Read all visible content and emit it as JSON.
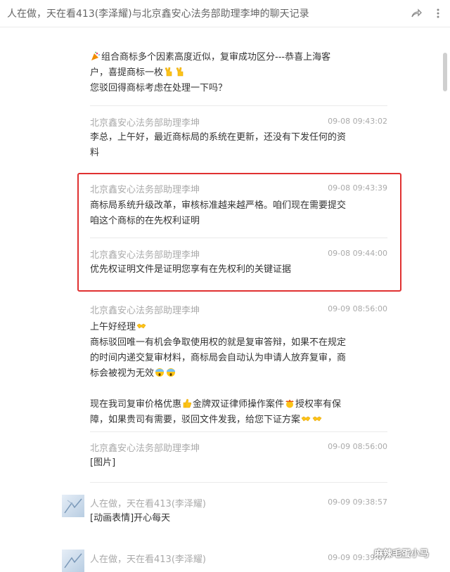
{
  "window": {
    "title": "人在做，天在看413(李泽耀)与北京鑫安心法务部助理李坤的聊天记录"
  },
  "messages": [
    {
      "lines": [
        "组合商标多个因素高度近似，复审成功区分---恭喜上海客",
        "户，喜提商标一枚",
        "您驳回得商标考虑在处理一下吗？"
      ]
    },
    {
      "sender": "北京鑫安心法务部助理李坤",
      "time": "09-08 09:43:02",
      "lines": [
        "李总，上午好，最近商标局的系统在更新，还没有下发任何的资",
        "料"
      ]
    },
    {
      "sender": "北京鑫安心法务部助理李坤",
      "time": "09-08 09:43:39",
      "lines": [
        "商标局系统升级改革，审核标准越来越严格。咱们现在需要提交",
        "咱这个商标的在先权利证明"
      ]
    },
    {
      "sender": "北京鑫安心法务部助理李坤",
      "time": "09-08 09:44:00",
      "lines": [
        "优先权证明文件是证明您享有在先权利的关键证据"
      ]
    },
    {
      "sender": "北京鑫安心法务部助理李坤",
      "time": "09-09 08:56:00",
      "lines": [
        "上午好经理",
        "商标驳回唯一有机会争取使用权的就是复审答辩，如果不在规定",
        "的时间内递交复审材料，商标局会自动认为申请人放弃复审，商",
        "标会被视为无效",
        "",
        "现在我司复审价格优惠",
        "金牌双证律师操作案件",
        "授权率有保",
        "障，如果贵司有需要，驳回文件发我，给您下证方案"
      ]
    },
    {
      "sender": "北京鑫安心法务部助理李坤",
      "time": "09-09 08:56:00",
      "lines": [
        "[图片]"
      ]
    },
    {
      "sender": "人在做，天在看413(李泽耀)",
      "time": "09-09 09:38:57",
      "lines": [
        "[动画表情]开心每天"
      ]
    },
    {
      "sender": "人在做，天在看413(李泽耀)",
      "time": "09-09 09:39:07",
      "lines": []
    }
  ],
  "watermark": "麻辣毛蛋小马",
  "icons": {
    "share": "share-icon",
    "more": "more-icon",
    "party": "party-popper-icon",
    "victory": "victory-hand-icon",
    "handshake": "handshake-icon",
    "scream": "screaming-face-icon",
    "thumbs": "thumbs-up-icon",
    "cowboy": "cowboy-face-icon"
  },
  "colors": {
    "highlight": "#e03131",
    "secondary_text": "#aaaaaa",
    "body_text": "#333333"
  }
}
